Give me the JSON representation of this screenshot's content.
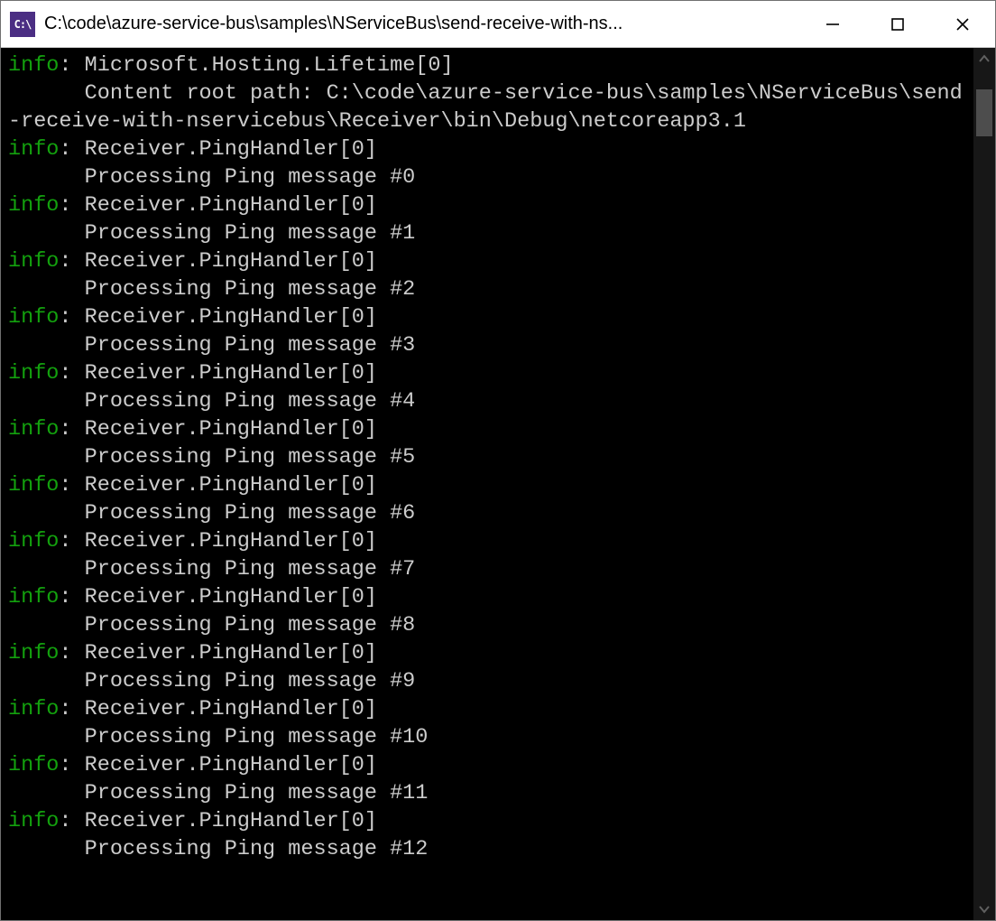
{
  "titlebar": {
    "icon_label": "C:\\",
    "title": "C:\\code\\azure-service-bus\\samples\\NServiceBus\\send-receive-with-ns..."
  },
  "logs": [
    {
      "level": "info",
      "source": "Microsoft.Hosting.Lifetime[0]",
      "message": "Content root path: C:\\code\\azure-service-bus\\samples\\NServiceBus\\send-receive-with-nservicebus\\Receiver\\bin\\Debug\\netcoreapp3.1"
    },
    {
      "level": "info",
      "source": "Receiver.PingHandler[0]",
      "message": "Processing Ping message #0"
    },
    {
      "level": "info",
      "source": "Receiver.PingHandler[0]",
      "message": "Processing Ping message #1"
    },
    {
      "level": "info",
      "source": "Receiver.PingHandler[0]",
      "message": "Processing Ping message #2"
    },
    {
      "level": "info",
      "source": "Receiver.PingHandler[0]",
      "message": "Processing Ping message #3"
    },
    {
      "level": "info",
      "source": "Receiver.PingHandler[0]",
      "message": "Processing Ping message #4"
    },
    {
      "level": "info",
      "source": "Receiver.PingHandler[0]",
      "message": "Processing Ping message #5"
    },
    {
      "level": "info",
      "source": "Receiver.PingHandler[0]",
      "message": "Processing Ping message #6"
    },
    {
      "level": "info",
      "source": "Receiver.PingHandler[0]",
      "message": "Processing Ping message #7"
    },
    {
      "level": "info",
      "source": "Receiver.PingHandler[0]",
      "message": "Processing Ping message #8"
    },
    {
      "level": "info",
      "source": "Receiver.PingHandler[0]",
      "message": "Processing Ping message #9"
    },
    {
      "level": "info",
      "source": "Receiver.PingHandler[0]",
      "message": "Processing Ping message #10"
    },
    {
      "level": "info",
      "source": "Receiver.PingHandler[0]",
      "message": "Processing Ping message #11"
    },
    {
      "level": "info",
      "source": "Receiver.PingHandler[0]",
      "message": "Processing Ping message #12"
    }
  ],
  "colors": {
    "log_level": "#13a10e",
    "console_fg": "#cccccc",
    "console_bg": "#000000"
  }
}
